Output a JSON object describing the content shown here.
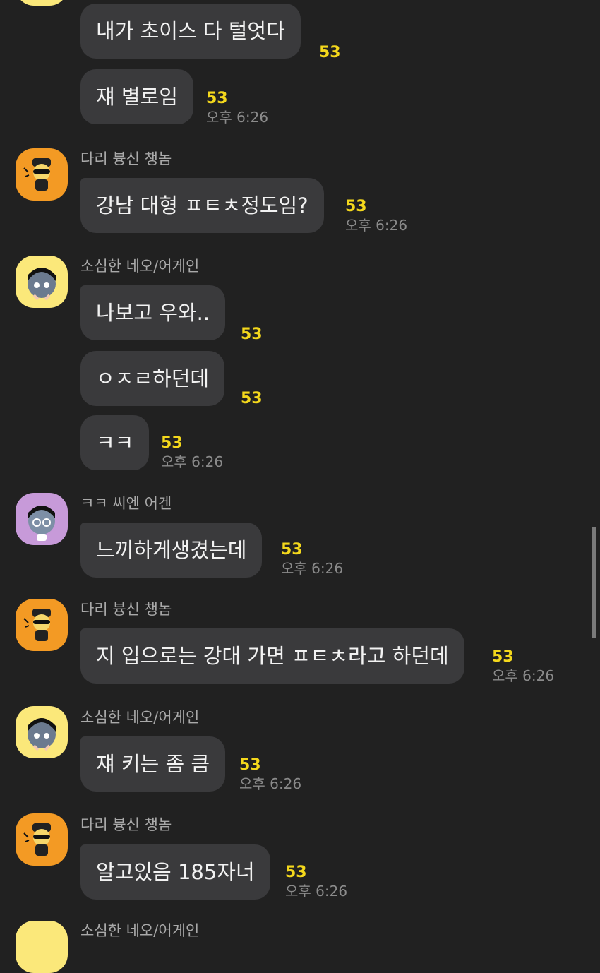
{
  "colors": {
    "background": "#212121",
    "bubble": "#3a3a3c",
    "message_text": "#f2f2f2",
    "sender_name": "#a9a9a9",
    "unread_count": "#f4d81c",
    "timestamp": "#8b8b8b",
    "avatar_yellow": "#fbe87a",
    "avatar_orange": "#f39a24",
    "avatar_purple": "#c79ad9"
  },
  "chat": {
    "m0": {
      "text": "내가 초이스 다 털엇다",
      "unread": "53"
    },
    "m1": {
      "text": "쟤 별로임",
      "unread": "53",
      "time": "오후 6:26"
    },
    "g1": {
      "sender": "다리 븅신 챙놈",
      "avatar_icon": "muzi-avatar-icon"
    },
    "m2": {
      "text": "강남 대형 ㅍㅌㅊ정도임?",
      "unread": "53",
      "time": "오후 6:26"
    },
    "g2": {
      "sender": "소심한 네오/어게인",
      "avatar_icon": "neo-avatar-icon"
    },
    "m3": {
      "text": "나보고 우와..",
      "unread": "53"
    },
    "m4": {
      "text": "ㅇㅈㄹ하던데",
      "unread": "53"
    },
    "m5": {
      "text": "ㅋㅋ",
      "unread": "53",
      "time": "오후 6:26"
    },
    "g3": {
      "sender": "ㅋㅋ 씨엔 어겐",
      "avatar_icon": "neo-avatar-icon"
    },
    "m6": {
      "text": "느끼하게생겼는데",
      "unread": "53",
      "time": "오후 6:26"
    },
    "g4": {
      "sender": "다리 븅신 챙놈",
      "avatar_icon": "muzi-avatar-icon"
    },
    "m7": {
      "text": "지 입으로는 강대 가면 ㅍㅌㅊ라고 하던데",
      "unread": "53",
      "time": "오후 6:26"
    },
    "g5": {
      "sender": "소심한 네오/어게인",
      "avatar_icon": "neo-avatar-icon"
    },
    "m8": {
      "text": "쟤 키는 좀 큼",
      "unread": "53",
      "time": "오후 6:26"
    },
    "g6": {
      "sender": "다리 븅신 챙놈",
      "avatar_icon": "muzi-avatar-icon"
    },
    "m9": {
      "text": "알고있음 185자너",
      "unread": "53",
      "time": "오후 6:26"
    },
    "g7": {
      "sender": "소심한 네오/어게인",
      "avatar_icon": "neo-avatar-icon"
    }
  }
}
